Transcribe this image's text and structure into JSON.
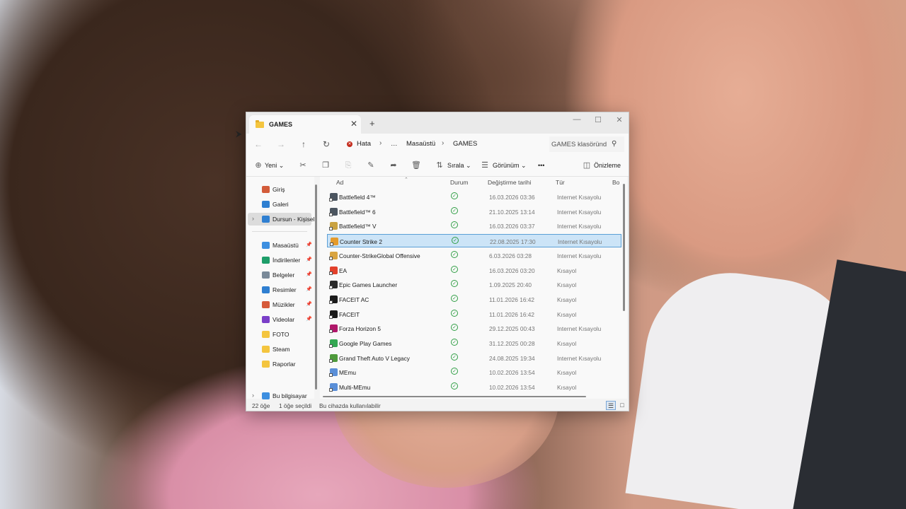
{
  "window": {
    "tab_title": "GAMES",
    "tab_close": "✕",
    "new_tab": "+"
  },
  "navbar": {
    "back": "←",
    "forward": "→",
    "up": "↑",
    "refresh": "↻",
    "breadcrumbs": [
      "Hata",
      "…",
      "Masaüstü",
      "GAMES"
    ],
    "search_placeholder": "GAMES klasöründ"
  },
  "toolbar": {
    "new_label": "Yeni",
    "sort_label": "Sırala",
    "view_label": "Görünüm",
    "more_label": "•••",
    "preview_label": "Önizleme"
  },
  "sidebar": {
    "items": [
      {
        "label": "Giriş",
        "icon": "home-icon",
        "color": "#d35c3a"
      },
      {
        "label": "Galeri",
        "icon": "gallery-icon",
        "color": "#2f7fd1"
      },
      {
        "label": "Dursun - Kişisel",
        "icon": "onedrive-icon",
        "color": "#2f7fd1"
      },
      {
        "label": "Masaüstü",
        "icon": "desktop-icon",
        "color": "#3d8fe0"
      },
      {
        "label": "İndirilenler",
        "icon": "download-icon",
        "color": "#1e9e6a"
      },
      {
        "label": "Belgeler",
        "icon": "documents-icon",
        "color": "#7a8a99"
      },
      {
        "label": "Resimler",
        "icon": "pictures-icon",
        "color": "#2f7fd1"
      },
      {
        "label": "Müzikler",
        "icon": "music-icon",
        "color": "#d65a3a"
      },
      {
        "label": "Videolar",
        "icon": "videos-icon",
        "color": "#7a3fc8"
      },
      {
        "label": "FOTO",
        "icon": "folder-icon",
        "color": "#f4c53f"
      },
      {
        "label": "Steam",
        "icon": "folder-icon",
        "color": "#f4c53f"
      },
      {
        "label": "Raporlar",
        "icon": "folder-icon",
        "color": "#f4c53f"
      },
      {
        "label": "Bu bilgisayar",
        "icon": "computer-icon",
        "color": "#3d8fe0"
      }
    ]
  },
  "columns": {
    "name": "Ad",
    "status": "Durum",
    "modified": "Değiştirme tarihi",
    "type": "Tür",
    "size": "Bo"
  },
  "files": [
    {
      "name": "Battlefield 4™",
      "date": "16.03.2026 03:36",
      "type": "Internet Kısayolu",
      "color": "#4b5560"
    },
    {
      "name": "Battlefield™ 6",
      "date": "21.10.2025 13:14",
      "type": "Internet Kısayolu",
      "color": "#4b5560"
    },
    {
      "name": "Battlefield™ V",
      "date": "16.03.2026 03:37",
      "type": "Internet Kısayolu",
      "color": "#c9a240"
    },
    {
      "name": "Counter Strike 2",
      "date": "22.08.2025 17:30",
      "type": "Internet Kısayolu",
      "color": "#e49b2d"
    },
    {
      "name": "Counter-StrikeGlobal Offensive",
      "date": "6.03.2026 03:28",
      "type": "Internet Kısayolu",
      "color": "#d9a440"
    },
    {
      "name": "EA",
      "date": "16.03.2026 03:20",
      "type": "Kısayol",
      "color": "#e2412b"
    },
    {
      "name": "Epic Games Launcher",
      "date": "1.09.2025 20:40",
      "type": "Kısayol",
      "color": "#2b2b2b"
    },
    {
      "name": "FACEIT AC",
      "date": "11.01.2026 16:42",
      "type": "Kısayol",
      "color": "#1b1b1b"
    },
    {
      "name": "FACEIT",
      "date": "11.01.2026 16:42",
      "type": "Kısayol",
      "color": "#1b1b1b"
    },
    {
      "name": "Forza Horizon 5",
      "date": "29.12.2025 00:43",
      "type": "Internet Kısayolu",
      "color": "#b0176a"
    },
    {
      "name": "Google Play Games",
      "date": "31.12.2025 00:28",
      "type": "Kısayol",
      "color": "#34a853"
    },
    {
      "name": "Grand Theft Auto V Legacy",
      "date": "24.08.2025 19:34",
      "type": "Internet Kısayolu",
      "color": "#4e9a3c"
    },
    {
      "name": "MEmu",
      "date": "10.02.2026 13:54",
      "type": "Kısayol",
      "color": "#5a8fd8"
    },
    {
      "name": "Multi-MEmu",
      "date": "10.02.2026 13:54",
      "type": "Kısayol",
      "color": "#5a8fd8"
    }
  ],
  "selected_file_index": 3,
  "status": {
    "item_count": "22 öğe",
    "selected": "1 öğe seçildi",
    "availability": "Bu cihazda kullanılabilir"
  }
}
